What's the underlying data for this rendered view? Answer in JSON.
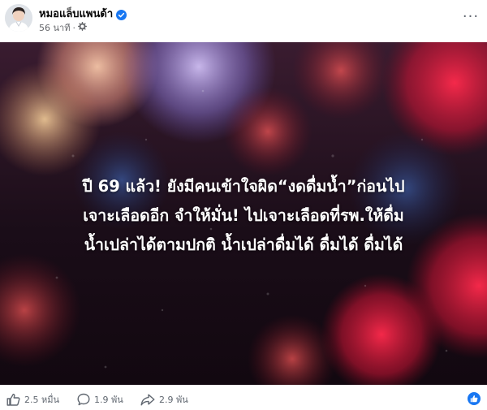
{
  "post": {
    "author": "หมอแล็บแพนด้า",
    "timestamp": "56 นาที",
    "separator": "·",
    "privacy_icon": "gear-icon",
    "verified_icon": "verified-badge-icon",
    "more_icon": "more-options-icon",
    "more_label": "···"
  },
  "image": {
    "text_lines": [
      "ปี 69 แล้ว! ยังมีคนเข้าใจผิด“งดดื่มน้ำ”ก่อนไป",
      "เจาะเลือดอีก จำให้มั่น! ไปเจาะเลือดที่รพ.ให้ดื่ม",
      "น้ำเปล่าได้ตามปกติ น้ำเปล่าดื่มได้ ดื่มได้ ดื่มได้"
    ]
  },
  "footer": {
    "likes": "2.5 หมื่น",
    "comments": "1.9 พัน",
    "shares": "2.9 พัน",
    "like_icon": "thumbs-up-icon",
    "comment_icon": "comment-bubble-icon",
    "share_icon": "share-arrow-icon",
    "reaction_icon": "like-reaction-icon"
  },
  "colors": {
    "accent": "#1877f2",
    "secondary_text": "#65676b"
  }
}
